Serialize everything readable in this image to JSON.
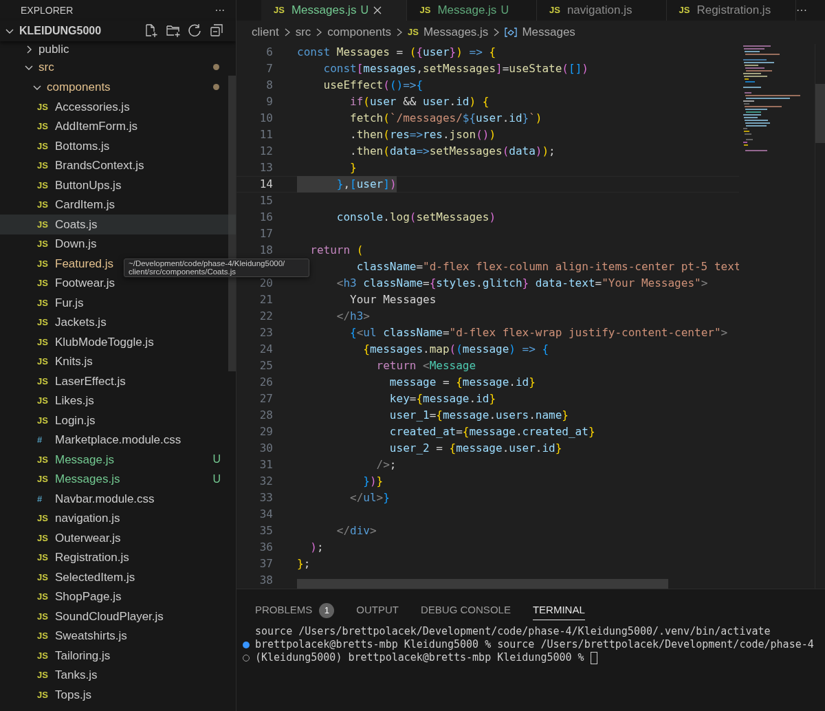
{
  "sidebar": {
    "title": "EXPLORER",
    "more": "···",
    "section": {
      "label": "KLEIDUNG5000",
      "expanded": true
    },
    "tree": [
      {
        "label": "public",
        "expanded": false,
        "modified": false
      },
      {
        "label": "src",
        "expanded": true,
        "modified": true,
        "children": [
          {
            "label": "components",
            "expanded": true,
            "modified": true,
            "children": [
              {
                "icon": "JS",
                "kind": "js",
                "label": "Accessories.js",
                "modified": false,
                "untracked": false,
                "hovered": false
              },
              {
                "icon": "JS",
                "kind": "js",
                "label": "AddItemForm.js",
                "modified": false,
                "untracked": false,
                "hovered": false
              },
              {
                "icon": "JS",
                "kind": "js",
                "label": "Bottoms.js",
                "modified": false,
                "untracked": false,
                "hovered": false
              },
              {
                "icon": "JS",
                "kind": "js",
                "label": "BrandsContext.js",
                "modified": false,
                "untracked": false,
                "hovered": false
              },
              {
                "icon": "JS",
                "kind": "js",
                "label": "ButtonUps.js",
                "modified": false,
                "untracked": false,
                "hovered": false
              },
              {
                "icon": "JS",
                "kind": "js",
                "label": "CardItem.js",
                "modified": false,
                "untracked": false,
                "hovered": false
              },
              {
                "icon": "JS",
                "kind": "js",
                "label": "Coats.js",
                "modified": false,
                "untracked": false,
                "hovered": true
              },
              {
                "icon": "JS",
                "kind": "js",
                "label": "Down.js",
                "modified": false,
                "untracked": false,
                "hovered": false
              },
              {
                "icon": "JS",
                "kind": "js",
                "label": "Featured.js",
                "modified": true,
                "untracked": false,
                "hovered": false
              },
              {
                "icon": "JS",
                "kind": "js",
                "label": "Footwear.js",
                "modified": false,
                "untracked": false,
                "hovered": false
              },
              {
                "icon": "JS",
                "kind": "js",
                "label": "Fur.js",
                "modified": false,
                "untracked": false,
                "hovered": false
              },
              {
                "icon": "JS",
                "kind": "js",
                "label": "Jackets.js",
                "modified": false,
                "untracked": false,
                "hovered": false
              },
              {
                "icon": "JS",
                "kind": "js",
                "label": "KlubModeToggle.js",
                "modified": false,
                "untracked": false,
                "hovered": false
              },
              {
                "icon": "JS",
                "kind": "js",
                "label": "Knits.js",
                "modified": false,
                "untracked": false,
                "hovered": false
              },
              {
                "icon": "JS",
                "kind": "js",
                "label": "LaserEffect.js",
                "modified": false,
                "untracked": false,
                "hovered": false
              },
              {
                "icon": "JS",
                "kind": "js",
                "label": "Likes.js",
                "modified": false,
                "untracked": false,
                "hovered": false
              },
              {
                "icon": "JS",
                "kind": "js",
                "label": "Login.js",
                "modified": false,
                "untracked": false,
                "hovered": false
              },
              {
                "icon": "#",
                "kind": "css",
                "label": "Marketplace.module.css",
                "modified": false,
                "untracked": false,
                "hovered": false
              },
              {
                "icon": "JS",
                "kind": "js",
                "label": "Message.js",
                "modified": false,
                "untracked": true,
                "badge": "U",
                "hovered": false
              },
              {
                "icon": "JS",
                "kind": "js",
                "label": "Messages.js",
                "modified": false,
                "untracked": true,
                "badge": "U",
                "hovered": false
              },
              {
                "icon": "#",
                "kind": "css",
                "label": "Navbar.module.css",
                "modified": false,
                "untracked": false,
                "hovered": false
              },
              {
                "icon": "JS",
                "kind": "js",
                "label": "navigation.js",
                "modified": false,
                "untracked": false,
                "hovered": false
              },
              {
                "icon": "JS",
                "kind": "js",
                "label": "Outerwear.js",
                "modified": false,
                "untracked": false,
                "hovered": false
              },
              {
                "icon": "JS",
                "kind": "js",
                "label": "Registration.js",
                "modified": false,
                "untracked": false,
                "hovered": false
              },
              {
                "icon": "JS",
                "kind": "js",
                "label": "SelectedItem.js",
                "modified": false,
                "untracked": false,
                "hovered": false
              },
              {
                "icon": "JS",
                "kind": "js",
                "label": "ShopPage.js",
                "modified": false,
                "untracked": false,
                "hovered": false
              },
              {
                "icon": "JS",
                "kind": "js",
                "label": "SoundCloudPlayer.js",
                "modified": false,
                "untracked": false,
                "hovered": false
              },
              {
                "icon": "JS",
                "kind": "js",
                "label": "Sweatshirts.js",
                "modified": false,
                "untracked": false,
                "hovered": false
              },
              {
                "icon": "JS",
                "kind": "js",
                "label": "Tailoring.js",
                "modified": false,
                "untracked": false,
                "hovered": false
              },
              {
                "icon": "JS",
                "kind": "js",
                "label": "Tanks.js",
                "modified": false,
                "untracked": false,
                "hovered": false
              },
              {
                "icon": "JS",
                "kind": "js",
                "label": "Tops.js",
                "modified": false,
                "untracked": false,
                "hovered": false
              }
            ]
          }
        ]
      }
    ]
  },
  "tooltip": {
    "lines": [
      "~/Development/code/phase-4/Kleidung5000/",
      "client/src/components/Coats.js"
    ]
  },
  "tabs": [
    {
      "icon": "JS",
      "label": "Messages.js",
      "badge": "U",
      "untracked": true,
      "selected": true
    },
    {
      "icon": "JS",
      "label": "Message.js",
      "badge": "U",
      "untracked": true,
      "selected": false
    },
    {
      "icon": "JS",
      "label": "navigation.js",
      "untracked": false,
      "selected": false
    },
    {
      "icon": "JS",
      "label": "Registration.js",
      "untracked": false,
      "selected": false
    }
  ],
  "tabs_more": "···",
  "breadcrumb": [
    {
      "kind": "folder",
      "text": "client"
    },
    {
      "kind": "folder",
      "text": "src"
    },
    {
      "kind": "folder",
      "text": "components"
    },
    {
      "kind": "file",
      "icon": "JS",
      "text": "Messages.js"
    },
    {
      "kind": "symbol",
      "text": "Messages"
    }
  ],
  "code": [
    {
      "number": "6",
      "current": false,
      "tokens": [
        {
          "text": "const",
          "kind": "kw"
        },
        {
          "text": " Messages",
          "kind": "fn"
        },
        {
          "text": " = ",
          "kind": "p"
        },
        {
          "text": "(",
          "kind": "b1"
        },
        {
          "text": "{",
          "kind": "b2"
        },
        {
          "text": "user",
          "kind": "var"
        },
        {
          "text": "}",
          "kind": "b2"
        },
        {
          "text": ")",
          "kind": "b1"
        },
        {
          "text": " =>",
          "kind": "kw"
        },
        {
          "text": " {",
          "kind": "b1"
        }
      ]
    },
    {
      "number": "7",
      "current": false,
      "tokens": [
        {
          "text": "    const",
          "kind": "kw"
        },
        {
          "text": "[",
          "kind": "b2"
        },
        {
          "text": "messages",
          "kind": "var"
        },
        {
          "text": ",",
          "kind": "p"
        },
        {
          "text": "setMessages",
          "kind": "fn"
        },
        {
          "text": "]",
          "kind": "b2"
        },
        {
          "text": "=",
          "kind": "p"
        },
        {
          "text": "useState",
          "kind": "fn"
        },
        {
          "text": "(",
          "kind": "b2"
        },
        {
          "text": "[]",
          "kind": "b3"
        },
        {
          "text": ")",
          "kind": "b2"
        }
      ]
    },
    {
      "number": "8",
      "current": false,
      "tokens": [
        {
          "text": "    useEffect",
          "kind": "fn"
        },
        {
          "text": "(",
          "kind": "b2"
        },
        {
          "text": "()",
          "kind": "b3"
        },
        {
          "text": "=>",
          "kind": "kw"
        },
        {
          "text": "{",
          "kind": "b3"
        }
      ]
    },
    {
      "number": "9",
      "current": false,
      "tokens": [
        {
          "text": "        if",
          "kind": "ctl"
        },
        {
          "text": "(",
          "kind": "b1"
        },
        {
          "text": "user",
          "kind": "var"
        },
        {
          "text": " && ",
          "kind": "p"
        },
        {
          "text": "user",
          "kind": "var"
        },
        {
          "text": ".",
          "kind": "p"
        },
        {
          "text": "id",
          "kind": "var"
        },
        {
          "text": ")",
          "kind": "b1"
        },
        {
          "text": " {",
          "kind": "b1"
        }
      ]
    },
    {
      "number": "10",
      "current": false,
      "tokens": [
        {
          "text": "        fetch",
          "kind": "fn"
        },
        {
          "text": "(",
          "kind": "b1"
        },
        {
          "text": "`/messages/",
          "kind": "str"
        },
        {
          "text": "${",
          "kind": "kw"
        },
        {
          "text": "user",
          "kind": "var"
        },
        {
          "text": ".",
          "kind": "p"
        },
        {
          "text": "id",
          "kind": "var"
        },
        {
          "text": "}",
          "kind": "kw"
        },
        {
          "text": "`",
          "kind": "str"
        },
        {
          "text": ")",
          "kind": "b1"
        }
      ]
    },
    {
      "number": "11",
      "current": false,
      "tokens": [
        {
          "text": "        .",
          "kind": "p"
        },
        {
          "text": "then",
          "kind": "fn"
        },
        {
          "text": "(",
          "kind": "b1"
        },
        {
          "text": "res",
          "kind": "var"
        },
        {
          "text": "=>",
          "kind": "kw"
        },
        {
          "text": "res",
          "kind": "var"
        },
        {
          "text": ".",
          "kind": "p"
        },
        {
          "text": "json",
          "kind": "fn"
        },
        {
          "text": "()",
          "kind": "b2"
        },
        {
          "text": ")",
          "kind": "b1"
        }
      ]
    },
    {
      "number": "12",
      "current": false,
      "tokens": [
        {
          "text": "        .",
          "kind": "p"
        },
        {
          "text": "then",
          "kind": "fn"
        },
        {
          "text": "(",
          "kind": "b1"
        },
        {
          "text": "data",
          "kind": "var"
        },
        {
          "text": "=>",
          "kind": "kw"
        },
        {
          "text": "setMessages",
          "kind": "fn"
        },
        {
          "text": "(",
          "kind": "b2"
        },
        {
          "text": "data",
          "kind": "var"
        },
        {
          "text": ")",
          "kind": "b2"
        },
        {
          "text": ")",
          "kind": "b1"
        },
        {
          "text": ";",
          "kind": "p"
        }
      ]
    },
    {
      "number": "13",
      "current": false,
      "tokens": [
        {
          "text": "        }",
          "kind": "b1"
        }
      ]
    },
    {
      "number": "14",
      "current": true,
      "tokens": [
        {
          "text": "      }",
          "kind": "b3"
        },
        {
          "text": ",",
          "kind": "p"
        },
        {
          "text": "[",
          "kind": "b3"
        },
        {
          "text": "user",
          "kind": "var"
        },
        {
          "text": "]",
          "kind": "b3"
        },
        {
          "text": ")",
          "kind": "b2"
        }
      ]
    },
    {
      "number": "15",
      "current": false
    },
    {
      "number": "16",
      "current": false,
      "tokens": [
        {
          "text": "      console",
          "kind": "var"
        },
        {
          "text": ".",
          "kind": "p"
        },
        {
          "text": "log",
          "kind": "fn"
        },
        {
          "text": "(",
          "kind": "b2"
        },
        {
          "text": "setMessages",
          "kind": "fn"
        },
        {
          "text": ")",
          "kind": "b2"
        }
      ]
    },
    {
      "number": "17",
      "current": false
    },
    {
      "number": "18",
      "current": false,
      "tokens": [
        {
          "text": "  return",
          "kind": "ctl"
        },
        {
          "text": " (",
          "kind": "b1"
        }
      ]
    },
    {
      "current": false,
      "tokens": [
        {
          "text": "         className",
          "kind": "var"
        },
        {
          "text": "=",
          "kind": "p"
        },
        {
          "text": "\"d-flex flex-column align-items-center pt-5 text",
          "kind": "str"
        }
      ]
    },
    {
      "number": "20",
      "current": false,
      "tokens": [
        {
          "text": "      <",
          "kind": "punc"
        },
        {
          "text": "h3",
          "kind": "tag"
        },
        {
          "text": " className",
          "kind": "var"
        },
        {
          "text": "=",
          "kind": "p"
        },
        {
          "text": "{",
          "kind": "b2"
        },
        {
          "text": "styles",
          "kind": "var"
        },
        {
          "text": ".",
          "kind": "p"
        },
        {
          "text": "glitch",
          "kind": "var"
        },
        {
          "text": "}",
          "kind": "b2"
        },
        {
          "text": " data-text",
          "kind": "var"
        },
        {
          "text": "=",
          "kind": "p"
        },
        {
          "text": "\"Your Messages\"",
          "kind": "str"
        },
        {
          "text": ">",
          "kind": "punc"
        }
      ]
    },
    {
      "number": "21",
      "current": false,
      "tokens": [
        {
          "text": "        Your Messages",
          "kind": "p"
        }
      ]
    },
    {
      "number": "22",
      "current": false,
      "tokens": [
        {
          "text": "      </",
          "kind": "punc"
        },
        {
          "text": "h3",
          "kind": "tag"
        },
        {
          "text": ">",
          "kind": "punc"
        }
      ]
    },
    {
      "number": "23",
      "current": false,
      "tokens": [
        {
          "text": "        {",
          "kind": "b3"
        },
        {
          "text": "<",
          "kind": "punc"
        },
        {
          "text": "ul",
          "kind": "tag"
        },
        {
          "text": " className",
          "kind": "var"
        },
        {
          "text": "=",
          "kind": "p"
        },
        {
          "text": "\"d-flex flex-wrap justify-content-center\"",
          "kind": "str"
        },
        {
          "text": ">",
          "kind": "punc"
        }
      ]
    },
    {
      "number": "24",
      "current": false,
      "tokens": [
        {
          "text": "          {",
          "kind": "b1"
        },
        {
          "text": "messages",
          "kind": "var"
        },
        {
          "text": ".",
          "kind": "p"
        },
        {
          "text": "map",
          "kind": "fn"
        },
        {
          "text": "(",
          "kind": "b2"
        },
        {
          "text": "(",
          "kind": "b3"
        },
        {
          "text": "message",
          "kind": "var"
        },
        {
          "text": ")",
          "kind": "b3"
        },
        {
          "text": " =>",
          "kind": "kw"
        },
        {
          "text": " {",
          "kind": "b3"
        }
      ]
    },
    {
      "number": "25",
      "current": false,
      "tokens": [
        {
          "text": "            return",
          "kind": "ctl"
        },
        {
          "text": " <",
          "kind": "punc"
        },
        {
          "text": "Message",
          "kind": "cmp"
        }
      ]
    },
    {
      "number": "26",
      "current": false,
      "tokens": [
        {
          "text": "              message",
          "kind": "var"
        },
        {
          "text": " = ",
          "kind": "p"
        },
        {
          "text": "{",
          "kind": "b1"
        },
        {
          "text": "message",
          "kind": "var"
        },
        {
          "text": ".",
          "kind": "p"
        },
        {
          "text": "id",
          "kind": "var"
        },
        {
          "text": "}",
          "kind": "b1"
        }
      ]
    },
    {
      "number": "27",
      "current": false,
      "tokens": [
        {
          "text": "              key",
          "kind": "var"
        },
        {
          "text": "=",
          "kind": "p"
        },
        {
          "text": "{",
          "kind": "b1"
        },
        {
          "text": "message",
          "kind": "var"
        },
        {
          "text": ".",
          "kind": "p"
        },
        {
          "text": "id",
          "kind": "var"
        },
        {
          "text": "}",
          "kind": "b1"
        }
      ]
    },
    {
      "number": "28",
      "current": false,
      "tokens": [
        {
          "text": "              user_1",
          "kind": "var"
        },
        {
          "text": "=",
          "kind": "p"
        },
        {
          "text": "{",
          "kind": "b1"
        },
        {
          "text": "message",
          "kind": "var"
        },
        {
          "text": ".",
          "kind": "p"
        },
        {
          "text": "users",
          "kind": "var"
        },
        {
          "text": ".",
          "kind": "p"
        },
        {
          "text": "name",
          "kind": "var"
        },
        {
          "text": "}",
          "kind": "b1"
        }
      ]
    },
    {
      "number": "29",
      "current": false,
      "tokens": [
        {
          "text": "              created_at",
          "kind": "var"
        },
        {
          "text": "=",
          "kind": "p"
        },
        {
          "text": "{",
          "kind": "b1"
        },
        {
          "text": "message",
          "kind": "var"
        },
        {
          "text": ".",
          "kind": "p"
        },
        {
          "text": "created_at",
          "kind": "var"
        },
        {
          "text": "}",
          "kind": "b1"
        }
      ]
    },
    {
      "number": "30",
      "current": false,
      "tokens": [
        {
          "text": "              user_2",
          "kind": "var"
        },
        {
          "text": " = ",
          "kind": "p"
        },
        {
          "text": "{",
          "kind": "b1"
        },
        {
          "text": "message",
          "kind": "var"
        },
        {
          "text": ".",
          "kind": "p"
        },
        {
          "text": "user",
          "kind": "var"
        },
        {
          "text": ".",
          "kind": "p"
        },
        {
          "text": "id",
          "kind": "var"
        },
        {
          "text": "}",
          "kind": "b1"
        }
      ]
    },
    {
      "number": "31",
      "current": false,
      "tokens": [
        {
          "text": "            />",
          "kind": "punc"
        },
        {
          "text": ";",
          "kind": "p"
        }
      ]
    },
    {
      "number": "32",
      "current": false,
      "tokens": [
        {
          "text": "          }",
          "kind": "b3"
        },
        {
          "text": ")",
          "kind": "b2"
        },
        {
          "text": "}",
          "kind": "b1"
        }
      ]
    },
    {
      "number": "33",
      "current": false,
      "tokens": [
        {
          "text": "        </",
          "kind": "punc"
        },
        {
          "text": "ul",
          "kind": "tag"
        },
        {
          "text": ">",
          "kind": "punc"
        },
        {
          "text": "}",
          "kind": "b3"
        }
      ]
    },
    {
      "number": "34",
      "current": false
    },
    {
      "number": "35",
      "current": false,
      "tokens": [
        {
          "text": "      </",
          "kind": "punc"
        },
        {
          "text": "div",
          "kind": "tag"
        },
        {
          "text": ">",
          "kind": "punc"
        }
      ]
    },
    {
      "number": "36",
      "current": false,
      "tokens": [
        {
          "text": "  )",
          "kind": "b2"
        },
        {
          "text": ";",
          "kind": "p"
        }
      ]
    },
    {
      "number": "37",
      "current": false,
      "tokens": [
        {
          "text": "}",
          "kind": "b1"
        },
        {
          "text": ";",
          "kind": "p"
        }
      ]
    },
    {
      "number": "38",
      "current": false
    }
  ],
  "panel": {
    "tabs": [
      {
        "label": "PROBLEMS",
        "badge": "1",
        "selected": false
      },
      {
        "label": "OUTPUT",
        "selected": false
      },
      {
        "label": "DEBUG CONSOLE",
        "selected": false
      },
      {
        "label": "TERMINAL",
        "selected": true
      }
    ],
    "terminal": [
      {
        "kind": "plain",
        "text": "source /Users/brettpolacek/Development/code/phase-4/Kleidung5000/.venv/bin/activate"
      },
      {
        "kind": "done",
        "text": "brettpolacek@bretts-mbp Kleidung5000 % source /Users/brettpolacek/Development/code/phase-4"
      },
      {
        "kind": "prompt",
        "text": "(Kleidung5000) brettpolacek@bretts-mbp Kleidung5000 %",
        "cursor": true
      }
    ]
  }
}
